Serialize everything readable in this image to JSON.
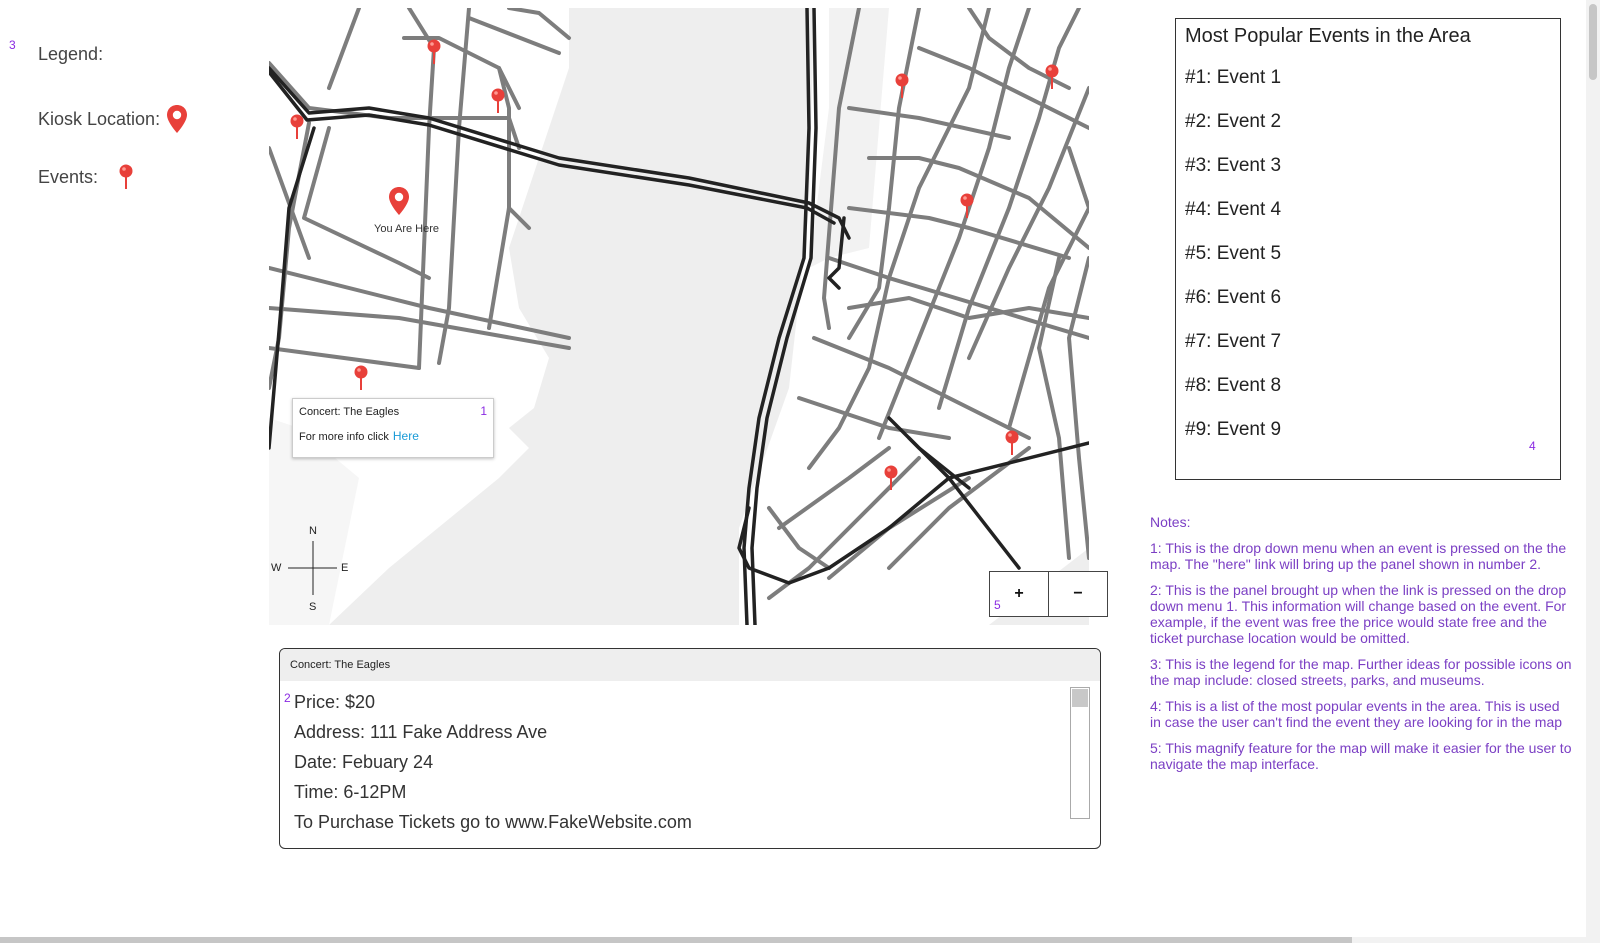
{
  "annotations": {
    "legend_marker": "3",
    "popup_marker": "1",
    "detail_marker": "2",
    "popular_marker": "4",
    "zoom_marker": "5"
  },
  "legend": {
    "title": "Legend:",
    "kiosk_label": "Kiosk Location:",
    "events_label": "Events:"
  },
  "map": {
    "you_are_here": "You Are Here",
    "pin_color": "#e8403a",
    "compass": {
      "n": "N",
      "s": "S",
      "e": "E",
      "w": "W"
    },
    "zoom": {
      "in_label": "+",
      "out_label": "−"
    }
  },
  "popup": {
    "title": "Concert:  The Eagles",
    "more_info": "For more info click",
    "link": "Here"
  },
  "detail": {
    "header": "Concert: The Eagles",
    "lines": [
      "Price: $20",
      "Address: 111 Fake Address Ave",
      "Date: Febuary 24",
      "Time: 6-12PM",
      "To Purchase Tickets go to www.FakeWebsite.com"
    ]
  },
  "popular": {
    "title": "Most Popular Events in the Area",
    "items": [
      "#1:  Event 1",
      "#2:  Event 2",
      "#3:  Event 3",
      "#4:  Event 4",
      "#5:  Event 5",
      "#6:  Event 6",
      "#7:  Event 7",
      "#8:  Event 8",
      "#9:  Event 9"
    ]
  },
  "notes": {
    "title": "Notes:",
    "items": [
      "1:  This is the drop down menu when an event is pressed on the the map.  The \"here\" link will bring up the panel shown in number 2.",
      "2:  This is the panel brought up when the link is pressed on the drop down menu 1.  This information will change based on the event.  For example, if the event was free the price would state free and the ticket purchase location would be omitted.",
      "3:  This is the legend for the map.  Further ideas for possible icons on the map include:  closed streets, parks, and museums.",
      "4: This is a list of the most popular events in the area.  This is used in case the user can't find the event they are looking for in the map",
      "5: This magnify feature for the map will make it easier for the user to navigate the map interface."
    ]
  },
  "colors": {
    "annotation": "#8a2be2",
    "notes": "#7b3fc4",
    "link": "#1a9bd7"
  }
}
